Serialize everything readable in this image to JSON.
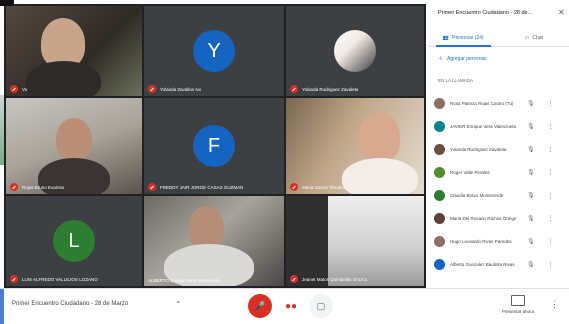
{
  "colors": {
    "tile_bg": "#3c4043",
    "avatar_y": "#1565c0",
    "avatar_f": "#1565c0",
    "avatar_l": "#2e7d32",
    "hangup_red": "#d93025",
    "accent_blue": "#1a73e8"
  },
  "tiles": [
    {
      "name": "Vo",
      "kind": "video"
    },
    {
      "name": "Yolanda Zavallos Ivo",
      "kind": "avatar",
      "initial": "Y"
    },
    {
      "name": "Yolanda Rodriguez Zavaleta",
      "kind": "photo"
    },
    {
      "name": "Rojas Bruno Evaristo",
      "kind": "video"
    },
    {
      "name": "FREDDY JAIR JORGE CASAS GUZMAN",
      "kind": "avatar",
      "initial": "F"
    },
    {
      "name": "Maria Garcia Timoteo",
      "kind": "video"
    },
    {
      "name": "LUIS ALFREDO VALLEJOS LOZANO",
      "kind": "avatar",
      "initial": "L"
    },
    {
      "name": "ALBERTO Enrique Vera Valenzuela",
      "kind": "video"
    },
    {
      "name": "Jeanet Matos Quintanilla Orozco",
      "kind": "video"
    }
  ],
  "bottom": {
    "meeting_title": "Primer Encuentro Ciudadano - 28 de Marzo",
    "chevron_icon": "chevron-up-icon",
    "present_label": "Presentar ahora",
    "more_icon": "more-vert-icon"
  },
  "side": {
    "title": "Primer Encuentro Ciudadano - 28 de...",
    "close_icon": "close-icon",
    "tab_people": "Personas (24)",
    "tab_chat": "Chat",
    "add_people": "Agregar personas",
    "section_label": "EN LA LLAMADA",
    "participants": [
      {
        "name": "Rosa Patricia Rojas Castro (Tú)",
        "color": "#8d6e63"
      },
      {
        "name": "JAVIER Enrique Vera Valenzuela",
        "color": "#00838f"
      },
      {
        "name": "Yolanda Rodriguez Zavaleta",
        "color": "#6d4c41"
      },
      {
        "name": "Roger Valle Perales",
        "color": "#558b2f"
      },
      {
        "name": "Claudia Bravo Monteverde",
        "color": "#2e7d32"
      },
      {
        "name": "Maria Del Rosario Ramos Ortega",
        "color": "#5d4037"
      },
      {
        "name": "Hugo Leonardo Rivas Paredes",
        "color": "#8d6e63"
      },
      {
        "name": "Alberto Gonzalez Bautista Rivas",
        "color": "#1565c0"
      }
    ]
  }
}
